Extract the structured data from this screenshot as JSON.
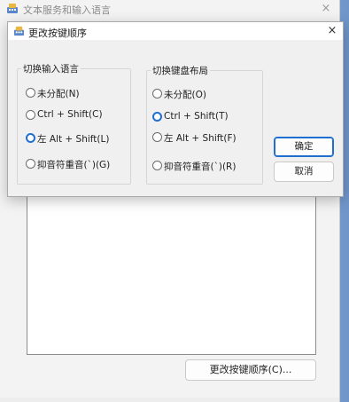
{
  "background_window": {
    "title": "文本服务和输入语言",
    "close_glyph": "×",
    "change_key_sequence_button": "更改按键顺序(C)..."
  },
  "dialog": {
    "title": "更改按键顺序",
    "close_glyph": "×",
    "input_language_group": {
      "legend": "切换输入语言",
      "options": [
        {
          "label": "未分配(N)",
          "checked": false
        },
        {
          "label": "Ctrl + Shift(C)",
          "checked": false
        },
        {
          "label": "左 Alt + Shift(L)",
          "checked": true
        },
        {
          "label": "抑音符重音(`)(G)",
          "checked": false
        }
      ]
    },
    "keyboard_layout_group": {
      "legend": "切换键盘布局",
      "options": [
        {
          "label": "未分配(O)",
          "checked": false
        },
        {
          "label": "Ctrl + Shift(T)",
          "checked": true
        },
        {
          "label": "左 Alt + Shift(F)",
          "checked": false
        },
        {
          "label": "抑音符重音(`)(R)",
          "checked": false
        }
      ]
    },
    "ok_button": "确定",
    "cancel_button": "取消"
  },
  "colors": {
    "accent": "#1f6fd1",
    "dialog_bg": "#f0f0f0",
    "desktop": "#9cc0ea"
  }
}
